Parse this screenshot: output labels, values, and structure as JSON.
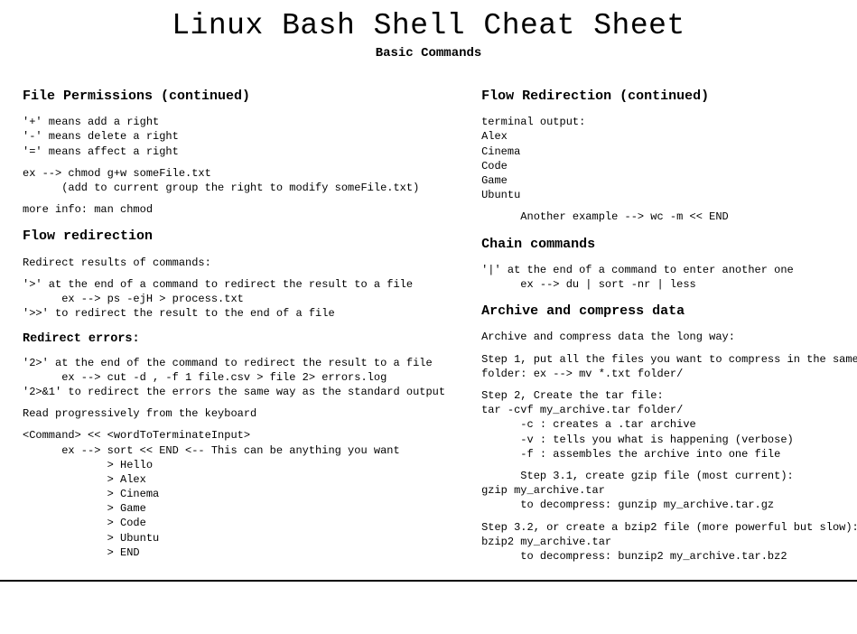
{
  "title": "Linux Bash Shell Cheat Sheet",
  "subtitle": "Basic Commands",
  "left": {
    "section1": {
      "heading": "File Permissions (continued)",
      "p1": "'+' means add a right\n'-' means delete a right\n'=' means affect a right",
      "p2": "ex --> chmod g+w someFile.txt\n      (add to current group the right to modify someFile.txt)",
      "p3": "more info: man chmod"
    },
    "section2": {
      "heading": "Flow redirection",
      "p1": "Redirect results of commands:",
      "p2": "'>' at the end of a command to redirect the result to a file\n      ex --> ps -ejH > process.txt\n'>>' to redirect the result to the end of a file",
      "subheading": "Redirect errors:",
      "p3": "'2>' at the end of the command to redirect the result to a file\n      ex --> cut -d , -f 1 file.csv > file 2> errors.log\n'2>&1' to redirect the errors the same way as the standard output",
      "p4": "Read progressively from the keyboard",
      "p5": "<Command> << <wordToTerminateInput>\n      ex --> sort << END <-- This can be anything you want\n             > Hello\n             > Alex\n             > Cinema\n             > Game\n             > Code\n             > Ubuntu\n             > END"
    }
  },
  "right": {
    "section1": {
      "heading": "Flow Redirection (continued)",
      "p1": "terminal output:\nAlex\nCinema\nCode\nGame\nUbuntu",
      "p2": "      Another example --> wc -m << END"
    },
    "section2": {
      "heading": "Chain commands",
      "p1": "'|' at the end of a command to enter another one\n      ex --> du | sort -nr | less"
    },
    "section3": {
      "heading": "Archive and compress data",
      "p1": "Archive and compress data the long way:",
      "p2": "Step 1, put all the files you want to compress in the same folder: ex --> mv *.txt folder/",
      "p3": "Step 2, Create the tar file:\ntar -cvf my_archive.tar folder/\n      -c : creates a .tar archive\n      -v : tells you what is happening (verbose)\n      -f : assembles the archive into one file",
      "p4": "      Step 3.1, create gzip file (most current):\ngzip my_archive.tar\n      to decompress: gunzip my_archive.tar.gz",
      "p5": "Step 3.2, or create a bzip2 file (more powerful but slow):\nbzip2 my_archive.tar\n      to decompress: bunzip2 my_archive.tar.bz2"
    }
  }
}
